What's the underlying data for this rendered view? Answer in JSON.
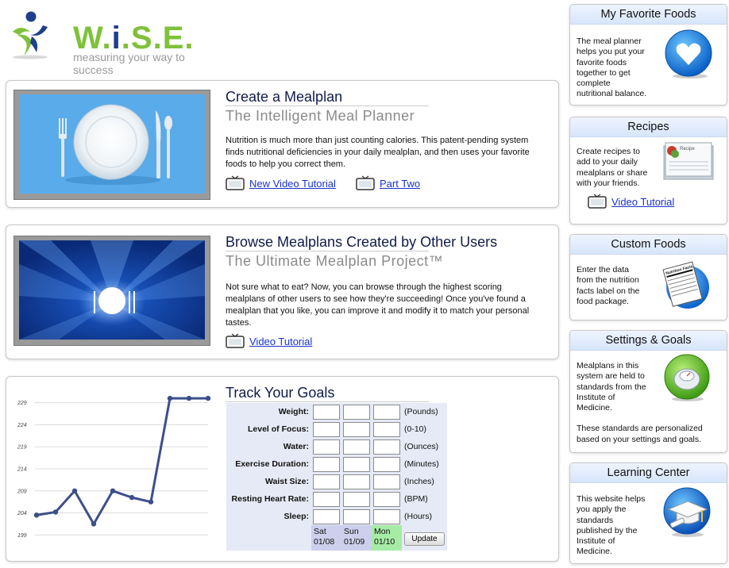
{
  "logo": {
    "word": "W.i.S.E.",
    "tagline": "measuring your way to success"
  },
  "panels": {
    "mealplan": {
      "title": "Create a Mealplan",
      "subtitle": "The Intelligent Meal Planner",
      "description": "Nutrition is much more than just counting calories.  This patent-pending system finds nutritional deficiencies in your daily mealplan, and then uses your favorite foods to help you correct them.",
      "links": [
        "New Video Tutorial",
        "Part Two"
      ]
    },
    "browse": {
      "title": "Browse Mealplans Created by Other Users",
      "subtitle": "The Ultimate Mealplan Project™",
      "description": "Not sure what to eat?  Now, you can browse through the highest scoring mealplans of other users to see how they're succeeding!  Once you've found a mealplan that you like, you can improve it and modify it to match your personal tastes.",
      "links": [
        "Video Tutorial"
      ]
    },
    "goals": {
      "title": "Track Your Goals",
      "rows": [
        {
          "label": "Weight:",
          "unit": "(Pounds)"
        },
        {
          "label": "Level of Focus:",
          "unit": "(0-10)"
        },
        {
          "label": "Water:",
          "unit": "(Ounces)"
        },
        {
          "label": "Exercise Duration:",
          "unit": "(Minutes)"
        },
        {
          "label": "Waist Size:",
          "unit": "(Inches)"
        },
        {
          "label": "Resting Heart Rate:",
          "unit": "(BPM)"
        },
        {
          "label": "Sleep:",
          "unit": "(Hours)"
        }
      ],
      "days": [
        {
          "day": "Sat",
          "date": "01/08"
        },
        {
          "day": "Sun",
          "date": "01/09"
        },
        {
          "day": "Mon",
          "date": "01/10"
        }
      ],
      "update_label": "Update"
    }
  },
  "chart_data": {
    "type": "line",
    "title": "",
    "xlabel": "",
    "ylabel": "",
    "y_ticks": [
      229,
      224,
      219,
      214,
      209,
      204,
      199
    ],
    "ylim": [
      196,
      232
    ],
    "values": [
      203.5,
      204.2,
      209,
      201.5,
      209,
      207.5,
      206.5,
      230,
      230,
      230
    ],
    "color": "#3d4f8a",
    "grid": true
  },
  "sidebar": {
    "favorites": {
      "title": "My Favorite Foods",
      "description": [
        "The meal planner",
        "helps you put your",
        "favorite foods",
        "together to get",
        "complete",
        "nutritional balance."
      ]
    },
    "recipes": {
      "title": "Recipes",
      "description": [
        "Create recipes to",
        "add to your daily",
        "mealplans or share",
        "with your friends."
      ],
      "link": "Video Tutorial",
      "card_label": "Recipe"
    },
    "custom": {
      "title": "Custom Foods",
      "description": [
        "Enter the data",
        "from the nutrition",
        "facts label on the",
        "food package."
      ],
      "label_text": "Nutrition Facts"
    },
    "settings": {
      "title": "Settings & Goals",
      "description": [
        "Mealplans in this",
        "system are held to",
        "standards from the",
        "Institute of",
        "Medicine.",
        "",
        "These standards are personalized",
        "based on your settings and goals."
      ]
    },
    "learning": {
      "title": "Learning Center",
      "description": [
        "This website helps",
        "you apply the",
        "standards",
        "published by the",
        "Institute of",
        "Medicine."
      ]
    }
  },
  "colors": {
    "brand_green": "#7fc13a",
    "brand_blue": "#1f3f8c",
    "link": "#1a33cc",
    "today_highlight": "#a6eba6"
  }
}
